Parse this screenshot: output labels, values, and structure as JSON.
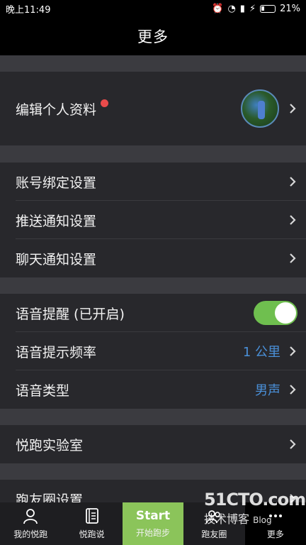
{
  "status_bar": {
    "time": "晚上11:49",
    "battery": "21%"
  },
  "nav": {
    "title": "更多"
  },
  "sections": {
    "profile": {
      "label": "编辑个人资料"
    },
    "account": [
      {
        "label": "账号绑定设置"
      },
      {
        "label": "推送通知设置"
      },
      {
        "label": "聊天通知设置"
      }
    ],
    "voice": {
      "reminder_label": "语音提醒 (已开启)",
      "reminder_on": true,
      "frequency_label": "语音提示频率",
      "frequency_value": "1 公里",
      "type_label": "语音类型",
      "type_value": "男声"
    },
    "lab": {
      "label": "悦跑实验室"
    },
    "friends": {
      "label": "跑友圈设置"
    }
  },
  "tabbar": {
    "items": [
      {
        "label": "我的悦跑",
        "icon": "person-icon"
      },
      {
        "label": "悦跑说",
        "icon": "book-icon"
      },
      {
        "label": "开始跑步",
        "big": "Start"
      },
      {
        "label": "跑友圈",
        "icon": "friends-icon"
      },
      {
        "label": "更多",
        "icon": "more-icon"
      }
    ]
  },
  "colors": {
    "accent_green": "#6fbf4f",
    "value_blue": "#4a90d9",
    "badge_red": "#e94b4b"
  },
  "watermark": {
    "line1": "51CTO.com",
    "line2": "技术博客",
    "line3": "Blog"
  }
}
